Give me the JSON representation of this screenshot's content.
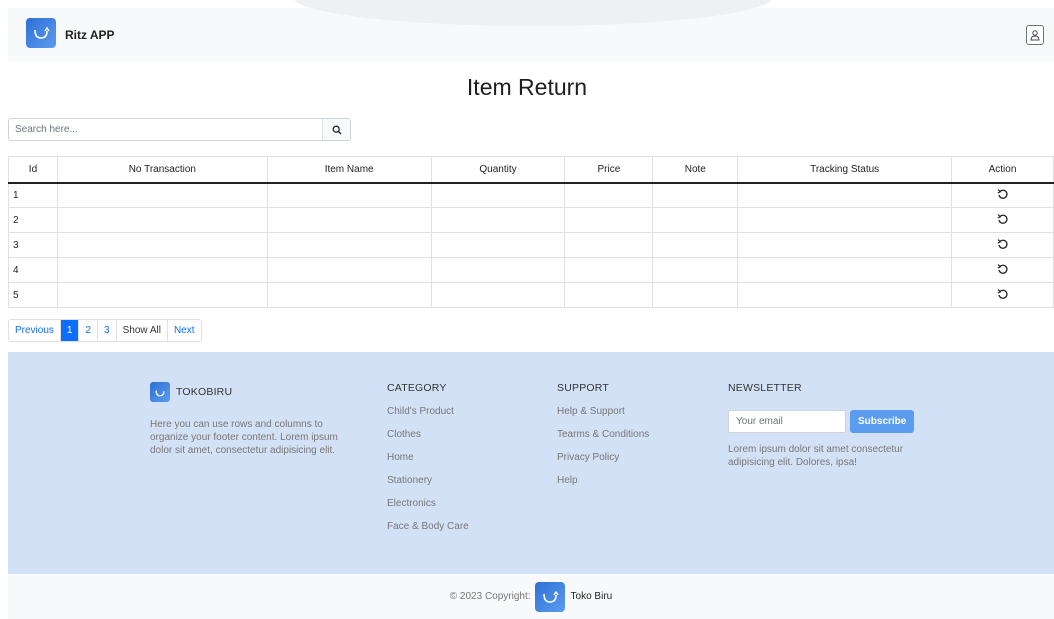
{
  "navbar": {
    "brand": "Ritz APP",
    "user_icon": "user-icon"
  },
  "page": {
    "title": "Item Return"
  },
  "search": {
    "placeholder": "Search here...",
    "icon": "search-icon"
  },
  "table": {
    "columns": [
      "Id",
      "No Transaction",
      "Item Name",
      "Quantity",
      "Price",
      "Note",
      "Tracking Status",
      "Action"
    ],
    "rows": [
      {
        "id": "1",
        "no_transaction": "",
        "item_name": "",
        "quantity": "",
        "price": "",
        "note": "",
        "tracking_status": ""
      },
      {
        "id": "2",
        "no_transaction": "",
        "item_name": "",
        "quantity": "",
        "price": "",
        "note": "",
        "tracking_status": ""
      },
      {
        "id": "3",
        "no_transaction": "",
        "item_name": "",
        "quantity": "",
        "price": "",
        "note": "",
        "tracking_status": ""
      },
      {
        "id": "4",
        "no_transaction": "",
        "item_name": "",
        "quantity": "",
        "price": "",
        "note": "",
        "tracking_status": ""
      },
      {
        "id": "5",
        "no_transaction": "",
        "item_name": "",
        "quantity": "",
        "price": "",
        "note": "",
        "tracking_status": ""
      }
    ],
    "action_icon": "undo-icon"
  },
  "pagination": {
    "previous": "Previous",
    "pages": [
      "1",
      "2",
      "3"
    ],
    "active_page": "1",
    "show_all": "Show All",
    "next": "Next"
  },
  "footer": {
    "brand": "TOKOBIRU",
    "about": "Here you can use rows and columns to organize your footer content. Lorem ipsum dolor sit amet, consectetur adipisicing elit.",
    "category": {
      "heading": "CATEGORY",
      "links": [
        "Child's Product",
        "Clothes",
        "Home",
        "Stationery",
        "Electronics",
        "Face & Body Care"
      ]
    },
    "support": {
      "heading": "SUPPORT",
      "links": [
        "Help & Support",
        "Tearms & Conditions",
        "Privacy Policy",
        "Help"
      ]
    },
    "newsletter": {
      "heading": "NEWSLETTER",
      "email_placeholder": "Your email",
      "subscribe_label": "Subscribe",
      "text": "Lorem ipsum dolor sit amet consectetur adipisicing elit. Dolores, ipsa!"
    }
  },
  "copyright": {
    "text": "© 2023 Copyright:",
    "brand": "Toko Biru"
  },
  "colors": {
    "primary": "#0d6efd",
    "footer_bg": "#d3e1f6",
    "subscribe_bg": "#5b9cf0",
    "logo_blue": "#2f6fd6"
  }
}
